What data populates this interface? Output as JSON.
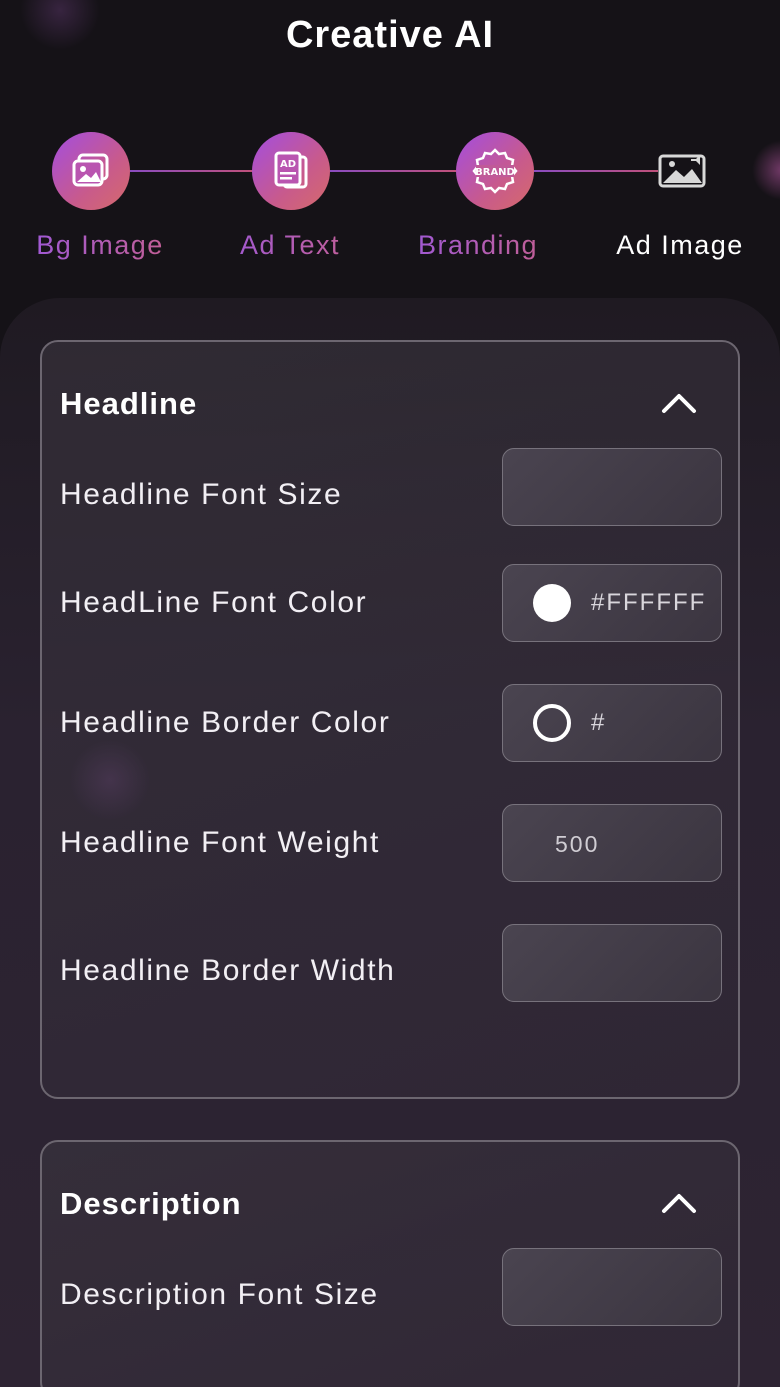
{
  "app": {
    "title": "Creative AI"
  },
  "steps": [
    {
      "label": "Bg Image",
      "icon": "image-icon",
      "state": "done"
    },
    {
      "label": "Ad Text",
      "icon": "ad-text-icon",
      "state": "done"
    },
    {
      "label": "Branding",
      "icon": "brand-icon",
      "state": "done"
    },
    {
      "label": "Ad Image",
      "icon": "ad-image-icon",
      "state": "current"
    }
  ],
  "headline": {
    "title": "Headline",
    "font_size_label": "Headline Font Size",
    "font_size_value": "",
    "font_color_label": "HeadLine Font Color",
    "font_color_value": "#FFFFFF",
    "border_color_label": "Headline Border Color",
    "border_color_value": "#",
    "font_weight_label": "Headline Font Weight",
    "font_weight_value": "500",
    "border_width_label": "Headline Border Width",
    "border_width_value": ""
  },
  "description": {
    "title": "Description",
    "font_size_label": "Description Font Size",
    "font_size_value": ""
  },
  "colors": {
    "accent_start": "#a34de0",
    "accent_end": "#d66a6a",
    "background": "#151217"
  }
}
